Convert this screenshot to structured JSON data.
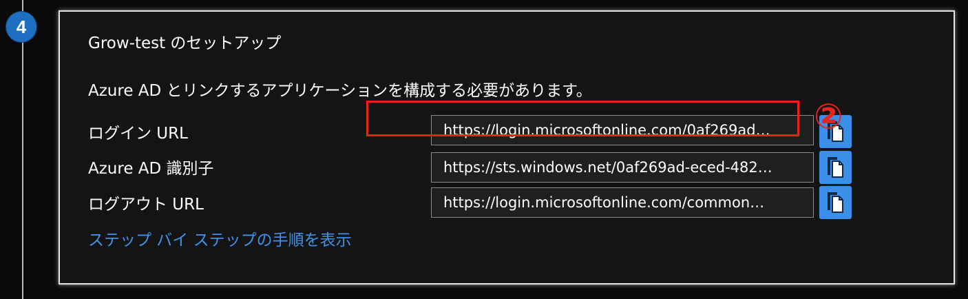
{
  "step": {
    "number": "4"
  },
  "card": {
    "title": "Grow-test のセットアップ",
    "description": "Azure AD とリンクするアプリケーションを構成する必要があります。",
    "rows": [
      {
        "label": "ログイン URL",
        "value": "https://login.microsoftonline.com/0af269ad…",
        "copy_icon": "copy-icon"
      },
      {
        "label": "Azure AD 識別子",
        "value": "https://sts.windows.net/0af269ad-eced-482…",
        "copy_icon": "copy-icon"
      },
      {
        "label": "ログアウト URL",
        "value": "https://login.microsoftonline.com/common…",
        "copy_icon": "copy-icon"
      }
    ],
    "link": "ステップ バイ ステップの手順を表示"
  },
  "annotation": {
    "callout": "②",
    "color": "#e8231a"
  },
  "colors": {
    "accent": "#3b8fe8",
    "badge": "#1f6fc0",
    "link": "#3f92e8"
  }
}
